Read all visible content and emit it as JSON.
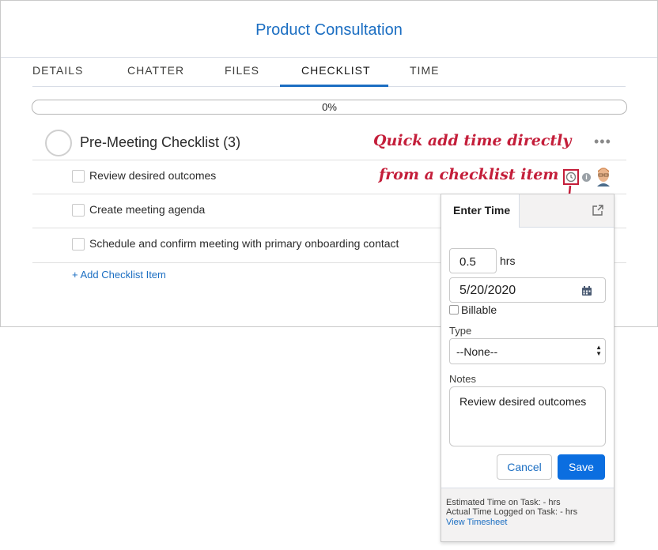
{
  "record": {
    "title": "Product Consultation"
  },
  "tabs": [
    {
      "label": "DETAILS"
    },
    {
      "label": "CHATTER"
    },
    {
      "label": "FILES"
    },
    {
      "label": "CHECKLIST",
      "active": true
    },
    {
      "label": "TIME"
    }
  ],
  "progress": {
    "label": "0%",
    "value": 0
  },
  "section": {
    "title": "Pre-Meeting Checklist (3)",
    "more_icon": "more-dots-icon"
  },
  "items": [
    {
      "label": "Review desired outcomes"
    },
    {
      "label": "Create meeting agenda"
    },
    {
      "label": "Schedule and confirm meeting with primary onboarding contact"
    }
  ],
  "add_item_label": "+ Add Checklist Item",
  "annotation": {
    "line1": "Quick add time directly",
    "line2": "from a checklist item"
  },
  "row_icons": [
    "clock-icon",
    "info-icon",
    "avatar"
  ],
  "popup": {
    "tab_label": "Enter Time",
    "hours_value": "0.5",
    "hours_unit": "hrs",
    "date_value": "5/20/2020",
    "billable_label": "Billable",
    "type_label": "Type",
    "type_value": "--None--",
    "notes_label": "Notes",
    "notes_value": "Review desired outcomes",
    "cancel_label": "Cancel",
    "save_label": "Save",
    "estimated_text": "Estimated Time on Task: - hrs",
    "actual_text": "Actual Time Logged on Task: - hrs",
    "timesheet_link": "View Timesheet"
  },
  "colors": {
    "brand": "#1b6ec2",
    "annotation": "#c41e3a"
  }
}
